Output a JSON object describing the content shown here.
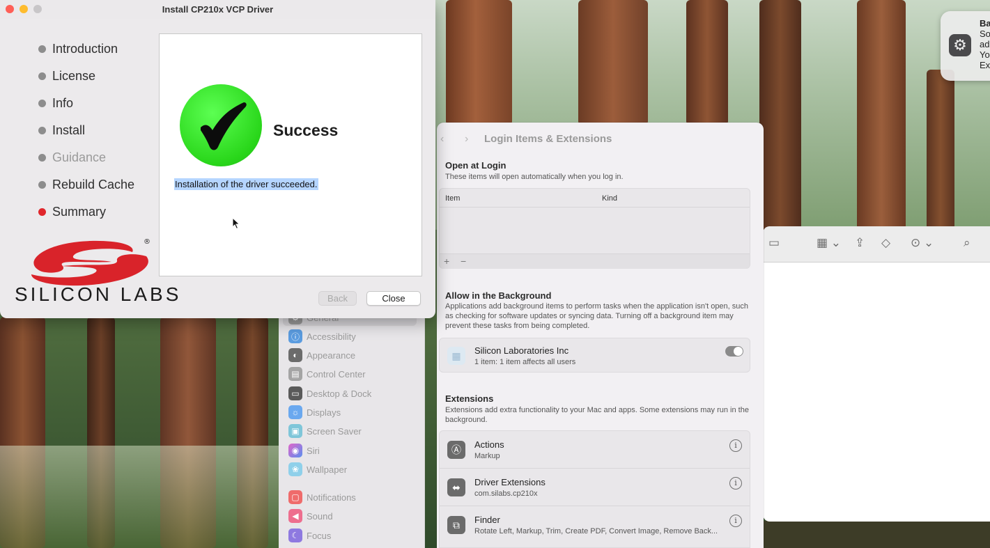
{
  "installer": {
    "title": "Install CP210x VCP Driver",
    "steps": [
      {
        "label": "Introduction",
        "state": "done"
      },
      {
        "label": "License",
        "state": "done"
      },
      {
        "label": "Info",
        "state": "done"
      },
      {
        "label": "Install",
        "state": "done"
      },
      {
        "label": "Guidance",
        "state": "skipped"
      },
      {
        "label": "Rebuild Cache",
        "state": "done"
      },
      {
        "label": "Summary",
        "state": "current"
      }
    ],
    "result_heading": "Success",
    "result_message": "Installation of the driver succeeded.",
    "back_label": "Back",
    "close_label": "Close",
    "logo_text": "SILICON LABS",
    "logo_mark": "®",
    "colors": {
      "current_step": "#e0262b",
      "success_green": "#29d61a",
      "logo_red": "#d9232a"
    }
  },
  "login_items": {
    "title": "Login Items & Extensions",
    "open_at_login": {
      "heading": "Open at Login",
      "description": "These items will open automatically when you log in.",
      "columns": [
        "Item",
        "Kind"
      ],
      "add": "+",
      "remove": "−"
    },
    "background": {
      "heading": "Allow in the Background",
      "description": "Applications add background items to perform tasks when the application isn't open, such as checking for software updates or syncing data. Turning off a background item may prevent these tasks from being completed.",
      "item_name": "Silicon Laboratories Inc",
      "item_detail": "1 item: 1 item affects all users"
    },
    "extensions": {
      "heading": "Extensions",
      "description": "Extensions add extra functionality to your Mac and apps. Some extensions may run in the background.",
      "items": [
        {
          "name": "Actions",
          "detail": "Markup"
        },
        {
          "name": "Driver Extensions",
          "detail": "com.silabs.cp210x"
        },
        {
          "name": "Finder",
          "detail": "Rotate Left, Markup, Trim, Create PDF, Convert Image, Remove Back..."
        }
      ]
    }
  },
  "settings_sidebar": {
    "items": [
      "General",
      "Accessibility",
      "Appearance",
      "Control Center",
      "Desktop & Dock",
      "Displays",
      "Screen Saver",
      "Siri",
      "Wallpaper",
      "Notifications",
      "Sound",
      "Focus"
    ]
  },
  "notification": {
    "lines": [
      "Ba",
      "So",
      "ad",
      "Yo",
      "Ex"
    ]
  }
}
